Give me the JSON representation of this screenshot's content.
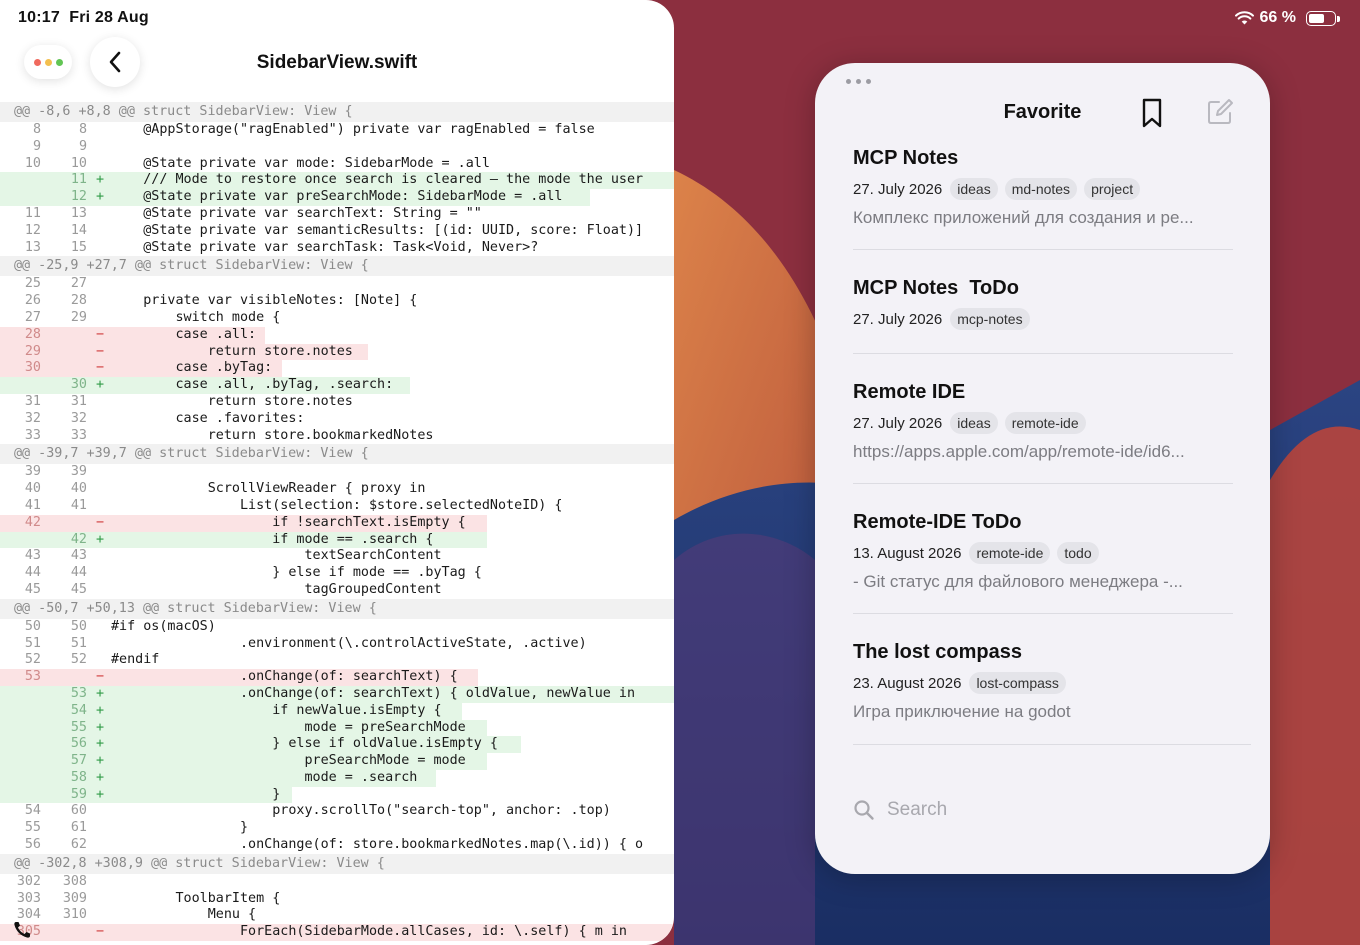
{
  "status": {
    "time": "10:17",
    "date": "Fri 28 Aug",
    "battery": "66 %",
    "battery_level": 0.66
  },
  "editor": {
    "title": "SidebarView.swift",
    "diff": [
      {
        "type": "hunk",
        "text": "@@ -8,6 +8,8 @@ struct SidebarView: View {"
      },
      {
        "type": "ctx",
        "n1": "8",
        "n2": "8",
        "code": "    @AppStorage(\"ragEnabled\") private var ragEnabled = false"
      },
      {
        "type": "ctx",
        "n1": "9",
        "n2": "9",
        "code": ""
      },
      {
        "type": "ctx",
        "n1": "10",
        "n2": "10",
        "code": "    @State private var mode: SidebarMode = .all"
      },
      {
        "type": "add",
        "n1": "",
        "n2": "11",
        "code": "    /// Mode to restore once search is cleared — the mode the user"
      },
      {
        "type": "add",
        "n1": "",
        "n2": "12",
        "code": "    @State private var preSearchMode: SidebarMode = .all"
      },
      {
        "type": "ctx",
        "n1": "11",
        "n2": "13",
        "code": "    @State private var searchText: String = \"\""
      },
      {
        "type": "ctx",
        "n1": "12",
        "n2": "14",
        "code": "    @State private var semanticResults: [(id: UUID, score: Float)]"
      },
      {
        "type": "ctx",
        "n1": "13",
        "n2": "15",
        "code": "    @State private var searchTask: Task<Void, Never>?"
      },
      {
        "type": "hunk",
        "text": "@@ -25,9 +27,7 @@ struct SidebarView: View {"
      },
      {
        "type": "ctx",
        "n1": "25",
        "n2": "27",
        "code": ""
      },
      {
        "type": "ctx",
        "n1": "26",
        "n2": "28",
        "code": "    private var visibleNotes: [Note] {"
      },
      {
        "type": "ctx",
        "n1": "27",
        "n2": "29",
        "code": "        switch mode {"
      },
      {
        "type": "del",
        "n1": "28",
        "n2": "",
        "code": "        case .all:"
      },
      {
        "type": "del",
        "n1": "29",
        "n2": "",
        "code": "            return store.notes"
      },
      {
        "type": "del",
        "n1": "30",
        "n2": "",
        "code": "        case .byTag:"
      },
      {
        "type": "add",
        "n1": "",
        "n2": "30",
        "code": "        case .all, .byTag, .search:"
      },
      {
        "type": "ctx",
        "n1": "31",
        "n2": "31",
        "code": "            return store.notes"
      },
      {
        "type": "ctx",
        "n1": "32",
        "n2": "32",
        "code": "        case .favorites:"
      },
      {
        "type": "ctx",
        "n1": "33",
        "n2": "33",
        "code": "            return store.bookmarkedNotes"
      },
      {
        "type": "hunk",
        "text": "@@ -39,7 +39,7 @@ struct SidebarView: View {"
      },
      {
        "type": "ctx",
        "n1": "39",
        "n2": "39",
        "code": ""
      },
      {
        "type": "ctx",
        "n1": "40",
        "n2": "40",
        "code": "            ScrollViewReader { proxy in"
      },
      {
        "type": "ctx",
        "n1": "41",
        "n2": "41",
        "code": "                List(selection: $store.selectedNoteID) {"
      },
      {
        "type": "del",
        "n1": "42",
        "n2": "",
        "code": "                    if !searchText.isEmpty {"
      },
      {
        "type": "add",
        "n1": "",
        "n2": "42",
        "code": "                    if mode == .search {"
      },
      {
        "type": "ctx",
        "n1": "43",
        "n2": "43",
        "code": "                        textSearchContent"
      },
      {
        "type": "ctx",
        "n1": "44",
        "n2": "44",
        "code": "                    } else if mode == .byTag {"
      },
      {
        "type": "ctx",
        "n1": "45",
        "n2": "45",
        "code": "                        tagGroupedContent"
      },
      {
        "type": "hunk",
        "text": "@@ -50,7 +50,13 @@ struct SidebarView: View {"
      },
      {
        "type": "ctx",
        "n1": "50",
        "n2": "50",
        "code": "#if os(macOS)"
      },
      {
        "type": "ctx",
        "n1": "51",
        "n2": "51",
        "code": "                .environment(\\.controlActiveState, .active)"
      },
      {
        "type": "ctx",
        "n1": "52",
        "n2": "52",
        "code": "#endif"
      },
      {
        "type": "del",
        "n1": "53",
        "n2": "",
        "code": "                .onChange(of: searchText) {"
      },
      {
        "type": "add",
        "n1": "",
        "n2": "53",
        "code": "                .onChange(of: searchText) { oldValue, newValue in"
      },
      {
        "type": "add",
        "n1": "",
        "n2": "54",
        "code": "                    if newValue.isEmpty {"
      },
      {
        "type": "add",
        "n1": "",
        "n2": "55",
        "code": "                        mode = preSearchMode"
      },
      {
        "type": "add",
        "n1": "",
        "n2": "56",
        "code": "                    } else if oldValue.isEmpty {"
      },
      {
        "type": "add",
        "n1": "",
        "n2": "57",
        "code": "                        preSearchMode = mode"
      },
      {
        "type": "add",
        "n1": "",
        "n2": "58",
        "code": "                        mode = .search"
      },
      {
        "type": "add",
        "n1": "",
        "n2": "59",
        "code": "                    }"
      },
      {
        "type": "ctx",
        "n1": "54",
        "n2": "60",
        "code": "                    proxy.scrollTo(\"search-top\", anchor: .top)"
      },
      {
        "type": "ctx",
        "n1": "55",
        "n2": "61",
        "code": "                }"
      },
      {
        "type": "ctx",
        "n1": "56",
        "n2": "62",
        "code": "                .onChange(of: store.bookmarkedNotes.map(\\.id)) { o"
      },
      {
        "type": "hunk",
        "text": "@@ -302,8 +308,9 @@ struct SidebarView: View {"
      },
      {
        "type": "ctx",
        "n1": "302",
        "n2": "308",
        "code": ""
      },
      {
        "type": "ctx",
        "n1": "303",
        "n2": "309",
        "code": "        ToolbarItem {"
      },
      {
        "type": "ctx",
        "n1": "304",
        "n2": "310",
        "code": "            Menu {"
      },
      {
        "type": "del",
        "n1": "305",
        "n2": "",
        "code": "                ForEach(SidebarMode.allCases, id: \\.self) { m in"
      }
    ]
  },
  "favorites": {
    "title": "Favorite",
    "notes": [
      {
        "title": "MCP Notes",
        "date": "27. July 2026",
        "tags": [
          "ideas",
          "md-notes",
          "project"
        ],
        "snippet": "Комплекс приложений для создания и ре..."
      },
      {
        "title": "MCP Notes  ToDo",
        "date": "27. July 2026",
        "tags": [
          "mcp-notes"
        ],
        "snippet": ""
      },
      {
        "title": "Remote IDE",
        "date": "27. July 2026",
        "tags": [
          "ideas",
          "remote-ide"
        ],
        "snippet": "https://apps.apple.com/app/remote-ide/id6..."
      },
      {
        "title": "Remote-IDE ToDo",
        "date": "13. August 2026",
        "tags": [
          "remote-ide",
          "todo"
        ],
        "snippet": "- Git статус для файлового менеджера -..."
      },
      {
        "title": "The lost compass",
        "date": "23. August 2026",
        "tags": [
          "lost-compass"
        ],
        "snippet": "Игра приключение на godot"
      }
    ],
    "search_placeholder": "Search"
  },
  "colors": {
    "add_bg": "#e4f6e6",
    "del_bg": "#fbe3e4",
    "traffic_red": "#f06a5e",
    "traffic_yellow": "#f3bf4f",
    "traffic_green": "#62c554"
  },
  "icons": [
    "chevron-left-icon",
    "bookmark-icon",
    "compose-icon",
    "search-icon",
    "phone-icon",
    "wifi-icon",
    "battery-icon"
  ]
}
